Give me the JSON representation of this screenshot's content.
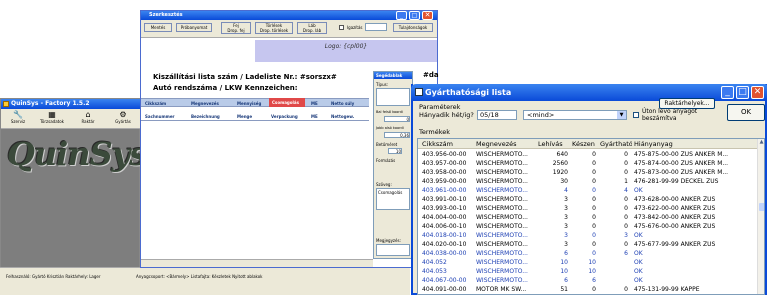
{
  "quinsys": {
    "title": "QuinSys - Factory 1.5.2",
    "toolbar": [
      "Szerviz",
      "Törzsadatok",
      "Raktár",
      "Gyártás"
    ],
    "logo": "QuinSys",
    "taskbar": "Felhasználó: Gyártó Krisztián   Raktárhely: Lager",
    "status_mid": "Anyagcsoport: <Bármely>   Listafajta: Készletek   Nyitott ablakok"
  },
  "report": {
    "title": "Szerkesztés",
    "toolbar": [
      "Mentés",
      "Próbanyomat",
      "Fej\nDrop. fej",
      "Törlések\nDrop. törlések",
      "Láb\nDrop. láb"
    ],
    "checkbox_label": "Igazítás",
    "tulajdonsagok": "Tulajdonságok",
    "logo": "Logo: {cpl00}",
    "heading": "Kiszállítási lista szám / Ladeliste Nr.: #sorszx#",
    "heading2": "Autó rendszáma / LKW Kennzeichen:",
    "heading_right": "Dá",
    "heading_right2": "#da",
    "header1": [
      "Cikkszám",
      "Megnevezés",
      "Mennyiség",
      "Csomagolás",
      "ME",
      "Netto súly"
    ],
    "header2": [
      "Sachnummer",
      "Bezeichnung",
      "Menge",
      "Verpackung",
      "ME",
      "Nettogew."
    ],
    "helper": {
      "title": "Segédablak",
      "labels": [
        "Típus:",
        "Bal felső koordi",
        "Jobb alsó koordi",
        "Betűméret",
        "Formázás",
        "Szöveg:",
        "Megjegyzés:"
      ],
      "x1": "0",
      "x2": "0,36",
      "size": "10",
      "text": "Csomagolás"
    }
  },
  "gyart": {
    "title": "Gyárthatósági lista",
    "params": "Paraméterek",
    "hanyadik": "Hányadik hét/ig?",
    "week": "05/18",
    "mind": "<mind>",
    "raktarhelyek": "Raktárhelyek...",
    "uton": "Úton levő anyagot beszámítva",
    "ok": "OK",
    "termekek": "Termékek",
    "columns": [
      "Cikkszám",
      "Megnevezés",
      "Lehívás",
      "Készen",
      "Gyártható",
      "Hiányanyag"
    ],
    "rows": [
      [
        "403.956-00-00",
        "WISCHERMOTO...",
        "640",
        "0",
        "0",
        "475-875-00-00 ZUS ANKER M..."
      ],
      [
        "403.957-00-00",
        "WISCHERMOTO...",
        "2560",
        "0",
        "0",
        "475-874-00-00 ZUS ANKER M..."
      ],
      [
        "403.958-00-00",
        "WISCHERMOTO...",
        "1920",
        "0",
        "0",
        "475-873-00-00 ZUS ANKER M..."
      ],
      [
        "403.959-00-00",
        "WISCHERMOTO...",
        "30",
        "0",
        "1",
        "476-281-99-99 DECKEL ZUS"
      ],
      [
        "403.961-00-00",
        "WISCHERMOTO...",
        "4",
        "0",
        "4",
        "OK"
      ],
      [
        "403.991-00-10",
        "WISCHERMOTO...",
        "3",
        "0",
        "0",
        "473-628-00-00 ANKER ZUS"
      ],
      [
        "403.993-00-10",
        "WISCHERMOTO...",
        "3",
        "0",
        "0",
        "473-622-00-00 ANKER ZUS"
      ],
      [
        "404.004-00-00",
        "WISCHERMOTO...",
        "3",
        "0",
        "0",
        "473-842-00-00 ANKER ZUS"
      ],
      [
        "404.006-00-10",
        "WISCHERMOTO...",
        "3",
        "0",
        "0",
        "475-676-00-00 ANKER ZUS"
      ],
      [
        "404.018-00-10",
        "WISCHERMOTO...",
        "3",
        "0",
        "3",
        "OK"
      ],
      [
        "404.020-00-10",
        "WISCHERMOTO...",
        "3",
        "0",
        "0",
        "475-677-99-99 ANKER ZUS"
      ],
      [
        "404.038-00-00",
        "WISCHERMOTO...",
        "6",
        "0",
        "6",
        "OK"
      ],
      [
        "404.052",
        "WISCHERMOTO...",
        "10",
        "10",
        "",
        "OK"
      ],
      [
        "404.053",
        "WISCHERMOTO...",
        "10",
        "10",
        "",
        "OK"
      ],
      [
        "404.067-00-00",
        "WISCHERMOTO...",
        "6",
        "6",
        "",
        "OK"
      ],
      [
        "404.091-00-00",
        "MOTOR MK SW...",
        "51",
        "0",
        "0",
        "475-131-99-99 KAPPE"
      ]
    ],
    "blue_rows": [
      4,
      9,
      11,
      12,
      13,
      14
    ]
  }
}
